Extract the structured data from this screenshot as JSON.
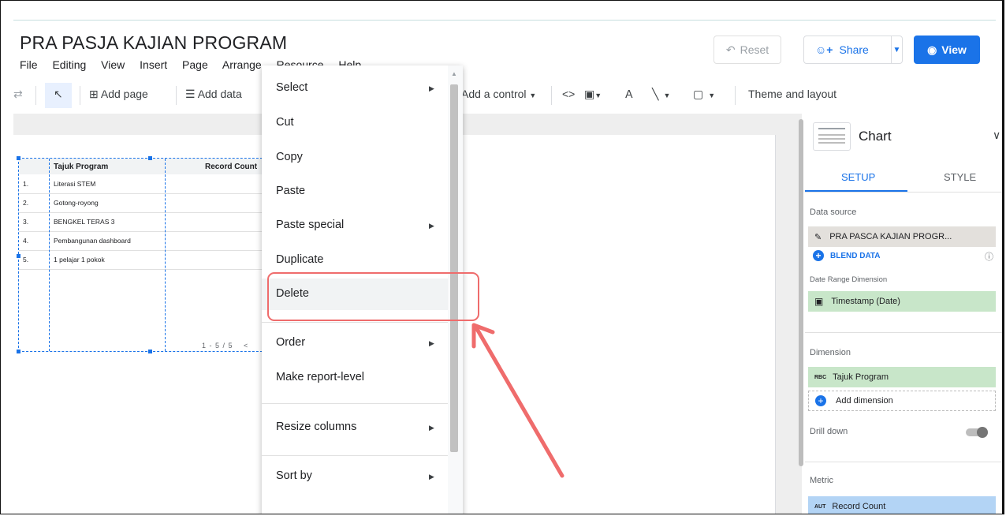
{
  "header": {
    "title": "PRA PASJA KAJIAN PROGRAM",
    "menus": [
      "File",
      "Editing",
      "View",
      "Insert",
      "Page",
      "Arrange",
      "Resource",
      "Help"
    ],
    "reset_label": "Reset",
    "share_label": "Share",
    "view_label": "View"
  },
  "toolbar": {
    "add_page_label": "Add page",
    "add_data_label": "Add data",
    "add_control_label": "Add a control",
    "theme_label": "Theme and layout"
  },
  "table": {
    "columns": [
      "Tajuk Program",
      "Record Count"
    ],
    "rows": [
      {
        "num": "1.",
        "name": "Literasi STEM"
      },
      {
        "num": "2.",
        "name": "Gotong-royong"
      },
      {
        "num": "3.",
        "name": "BENGKEL TERAS 3"
      },
      {
        "num": "4.",
        "name": "Pembangunan dashboard"
      },
      {
        "num": "5.",
        "name": "1 pelajar 1 pokok"
      }
    ],
    "pager": "1 - 5 / 5"
  },
  "context_menu": {
    "items": [
      {
        "label": "Select",
        "submenu": true
      },
      {
        "label": "Cut",
        "submenu": false
      },
      {
        "label": "Copy",
        "submenu": false
      },
      {
        "label": "Paste",
        "submenu": false
      },
      {
        "label": "Paste special",
        "submenu": true
      },
      {
        "label": "Duplicate",
        "submenu": false
      },
      {
        "label": "Delete",
        "submenu": false
      },
      {
        "label": "Order",
        "submenu": true
      },
      {
        "label": "Make report-level",
        "submenu": false
      },
      {
        "label": "Resize columns",
        "submenu": true
      },
      {
        "label": "Sort by",
        "submenu": true
      }
    ],
    "highlighted": "Delete"
  },
  "panel": {
    "title": "Chart",
    "tabs": [
      "SETUP",
      "STYLE"
    ],
    "data_source_label": "Data source",
    "data_source_value": "PRA PASCA KAJIAN PROGR...",
    "blend_label": "BLEND DATA",
    "date_range_label": "Date Range Dimension",
    "date_range_value": "Timestamp (Date)",
    "dimension_label": "Dimension",
    "dimension_value": "Tajuk Program",
    "dimension_type": "RBC",
    "add_dimension_label": "Add dimension",
    "drill_down_label": "Drill down",
    "metric_label": "Metric",
    "metric_value": "Record Count",
    "metric_type": "AUT"
  },
  "colors": {
    "accent": "#1a73e8",
    "annotation": "#ef6c6c",
    "chip_green": "#c8e6c9",
    "chip_blue": "#b3d4f5"
  }
}
